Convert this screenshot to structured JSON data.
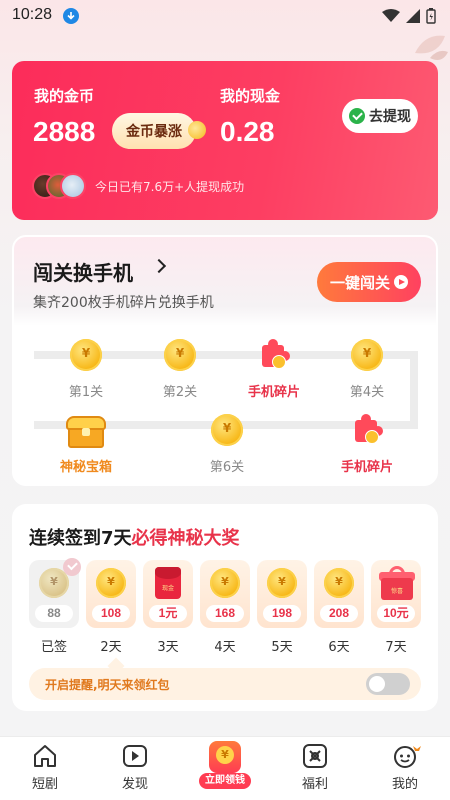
{
  "status_bar": {
    "time": "10:28"
  },
  "wallet": {
    "coin_label": "我的金币",
    "coin_value": "2888",
    "coin_badge": "金币暴涨",
    "cash_label": "我的现金",
    "cash_value": "0.28",
    "withdraw_button": "去提现",
    "withdraw_info": "今日已有7.6万+人提现成功"
  },
  "challenge": {
    "title": "闯关换手机",
    "subtitle": "集齐200枚手机碎片兑换手机",
    "button": "一键闯关",
    "coin_glyph": "¥",
    "stages": [
      {
        "label": "第1关",
        "type": "coin"
      },
      {
        "label": "第2关",
        "type": "coin"
      },
      {
        "label": "手机碎片",
        "type": "puzzle"
      },
      {
        "label": "第4关",
        "type": "coin"
      },
      {
        "label": "神秘宝箱",
        "type": "chest"
      },
      {
        "label": "第6关",
        "type": "coin"
      },
      {
        "label": "手机碎片",
        "type": "puzzle"
      }
    ]
  },
  "checkin": {
    "title_prefix": "连续签到7天",
    "title_highlight": "必得神秘大奖",
    "redpack_text": "现金",
    "gift_text": "惊喜",
    "days": [
      {
        "amount": "88",
        "label": "已签",
        "type": "coin",
        "done": true
      },
      {
        "amount": "108",
        "label": "2天",
        "type": "coin"
      },
      {
        "amount": "1元",
        "label": "3天",
        "type": "redpack"
      },
      {
        "amount": "168",
        "label": "4天",
        "type": "coin"
      },
      {
        "amount": "198",
        "label": "5天",
        "type": "coin"
      },
      {
        "amount": "208",
        "label": "6天",
        "type": "coin"
      },
      {
        "amount": "10元",
        "label": "7天",
        "type": "gift"
      }
    ],
    "reminder": "开启提醒,明天来领红包",
    "reminder_enabled": false
  },
  "nav": {
    "items": [
      {
        "label": "短剧",
        "icon": "home-icon"
      },
      {
        "label": "发现",
        "icon": "play-icon"
      },
      {
        "label": "立即领钱",
        "icon": "coin-icon"
      },
      {
        "label": "福利",
        "icon": "gift-grid-icon"
      },
      {
        "label": "我的",
        "icon": "profile-icon"
      }
    ]
  },
  "colors": {
    "accent": "#fc2c5a",
    "gold": "#f7b614",
    "highlight": "#e8334a"
  }
}
